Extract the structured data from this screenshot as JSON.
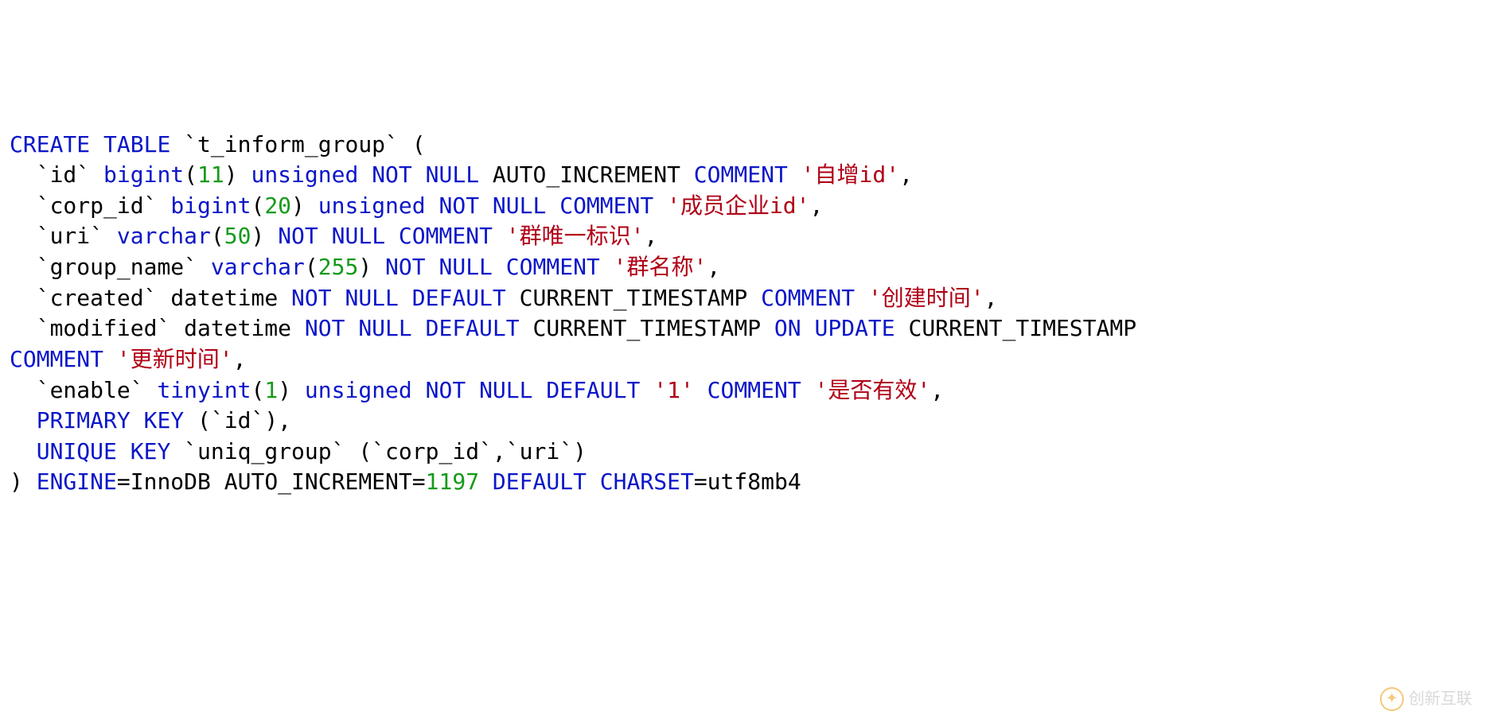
{
  "sql": {
    "create": "CREATE",
    "table": "TABLE",
    "tableName": "t_inform_group",
    "columns": {
      "id": {
        "name": "id",
        "type_kw": "bigint",
        "size": "11",
        "attrs1": "unsigned",
        "attrs2": "NOT",
        "attrs3": "NULL",
        "auto": "AUTO_INCREMENT",
        "comment_kw": "COMMENT",
        "comment": "'自增id'"
      },
      "corp_id": {
        "name": "corp_id",
        "type_kw": "bigint",
        "size": "20",
        "attrs1": "unsigned",
        "attrs2": "NOT",
        "attrs3": "NULL",
        "comment_kw": "COMMENT",
        "comment": "'成员企业id'"
      },
      "uri": {
        "name": "uri",
        "type_kw": "varchar",
        "size": "50",
        "attrs2": "NOT",
        "attrs3": "NULL",
        "comment_kw": "COMMENT",
        "comment": "'群唯一标识'"
      },
      "group_name": {
        "name": "group_name",
        "type_kw": "varchar",
        "size": "255",
        "attrs2": "NOT",
        "attrs3": "NULL",
        "comment_kw": "COMMENT",
        "comment": "'群名称'"
      },
      "created": {
        "name": "created",
        "type_kw": "datetime",
        "attrs2": "NOT",
        "attrs3": "NULL",
        "default_kw": "DEFAULT",
        "default_val": "CURRENT_TIMESTAMP",
        "comment_kw": "COMMENT",
        "comment": "'创建时间'"
      },
      "modified": {
        "name": "modified",
        "type_kw": "datetime",
        "attrs2": "NOT",
        "attrs3": "NULL",
        "default_kw": "DEFAULT",
        "default_val": "CURRENT_TIMESTAMP",
        "on_kw": "ON",
        "update_kw": "UPDATE",
        "update_val": "CURRENT_TIMESTAMP",
        "comment_kw": "COMMENT",
        "comment": "'更新时间'"
      },
      "enable": {
        "name": "enable",
        "type_kw": "tinyint",
        "size": "1",
        "attrs1": "unsigned",
        "attrs2": "NOT",
        "attrs3": "NULL",
        "default_kw": "DEFAULT",
        "default_str": "'1'",
        "comment_kw": "COMMENT",
        "comment": "'是否有效'"
      }
    },
    "pk": {
      "primary": "PRIMARY",
      "key": "KEY",
      "col": "id"
    },
    "uk": {
      "unique": "UNIQUE",
      "key": "KEY",
      "name": "uniq_group",
      "col1": "corp_id",
      "col2": "uri"
    },
    "engine_kw": "ENGINE",
    "engine_val": "InnoDB",
    "autoinc_kw": "AUTO_INCREMENT",
    "autoinc_val": "1197",
    "default_kw": "DEFAULT",
    "charset_kw": "CHARSET",
    "charset_val": "utf8mb4"
  },
  "watermark": "创新互联"
}
